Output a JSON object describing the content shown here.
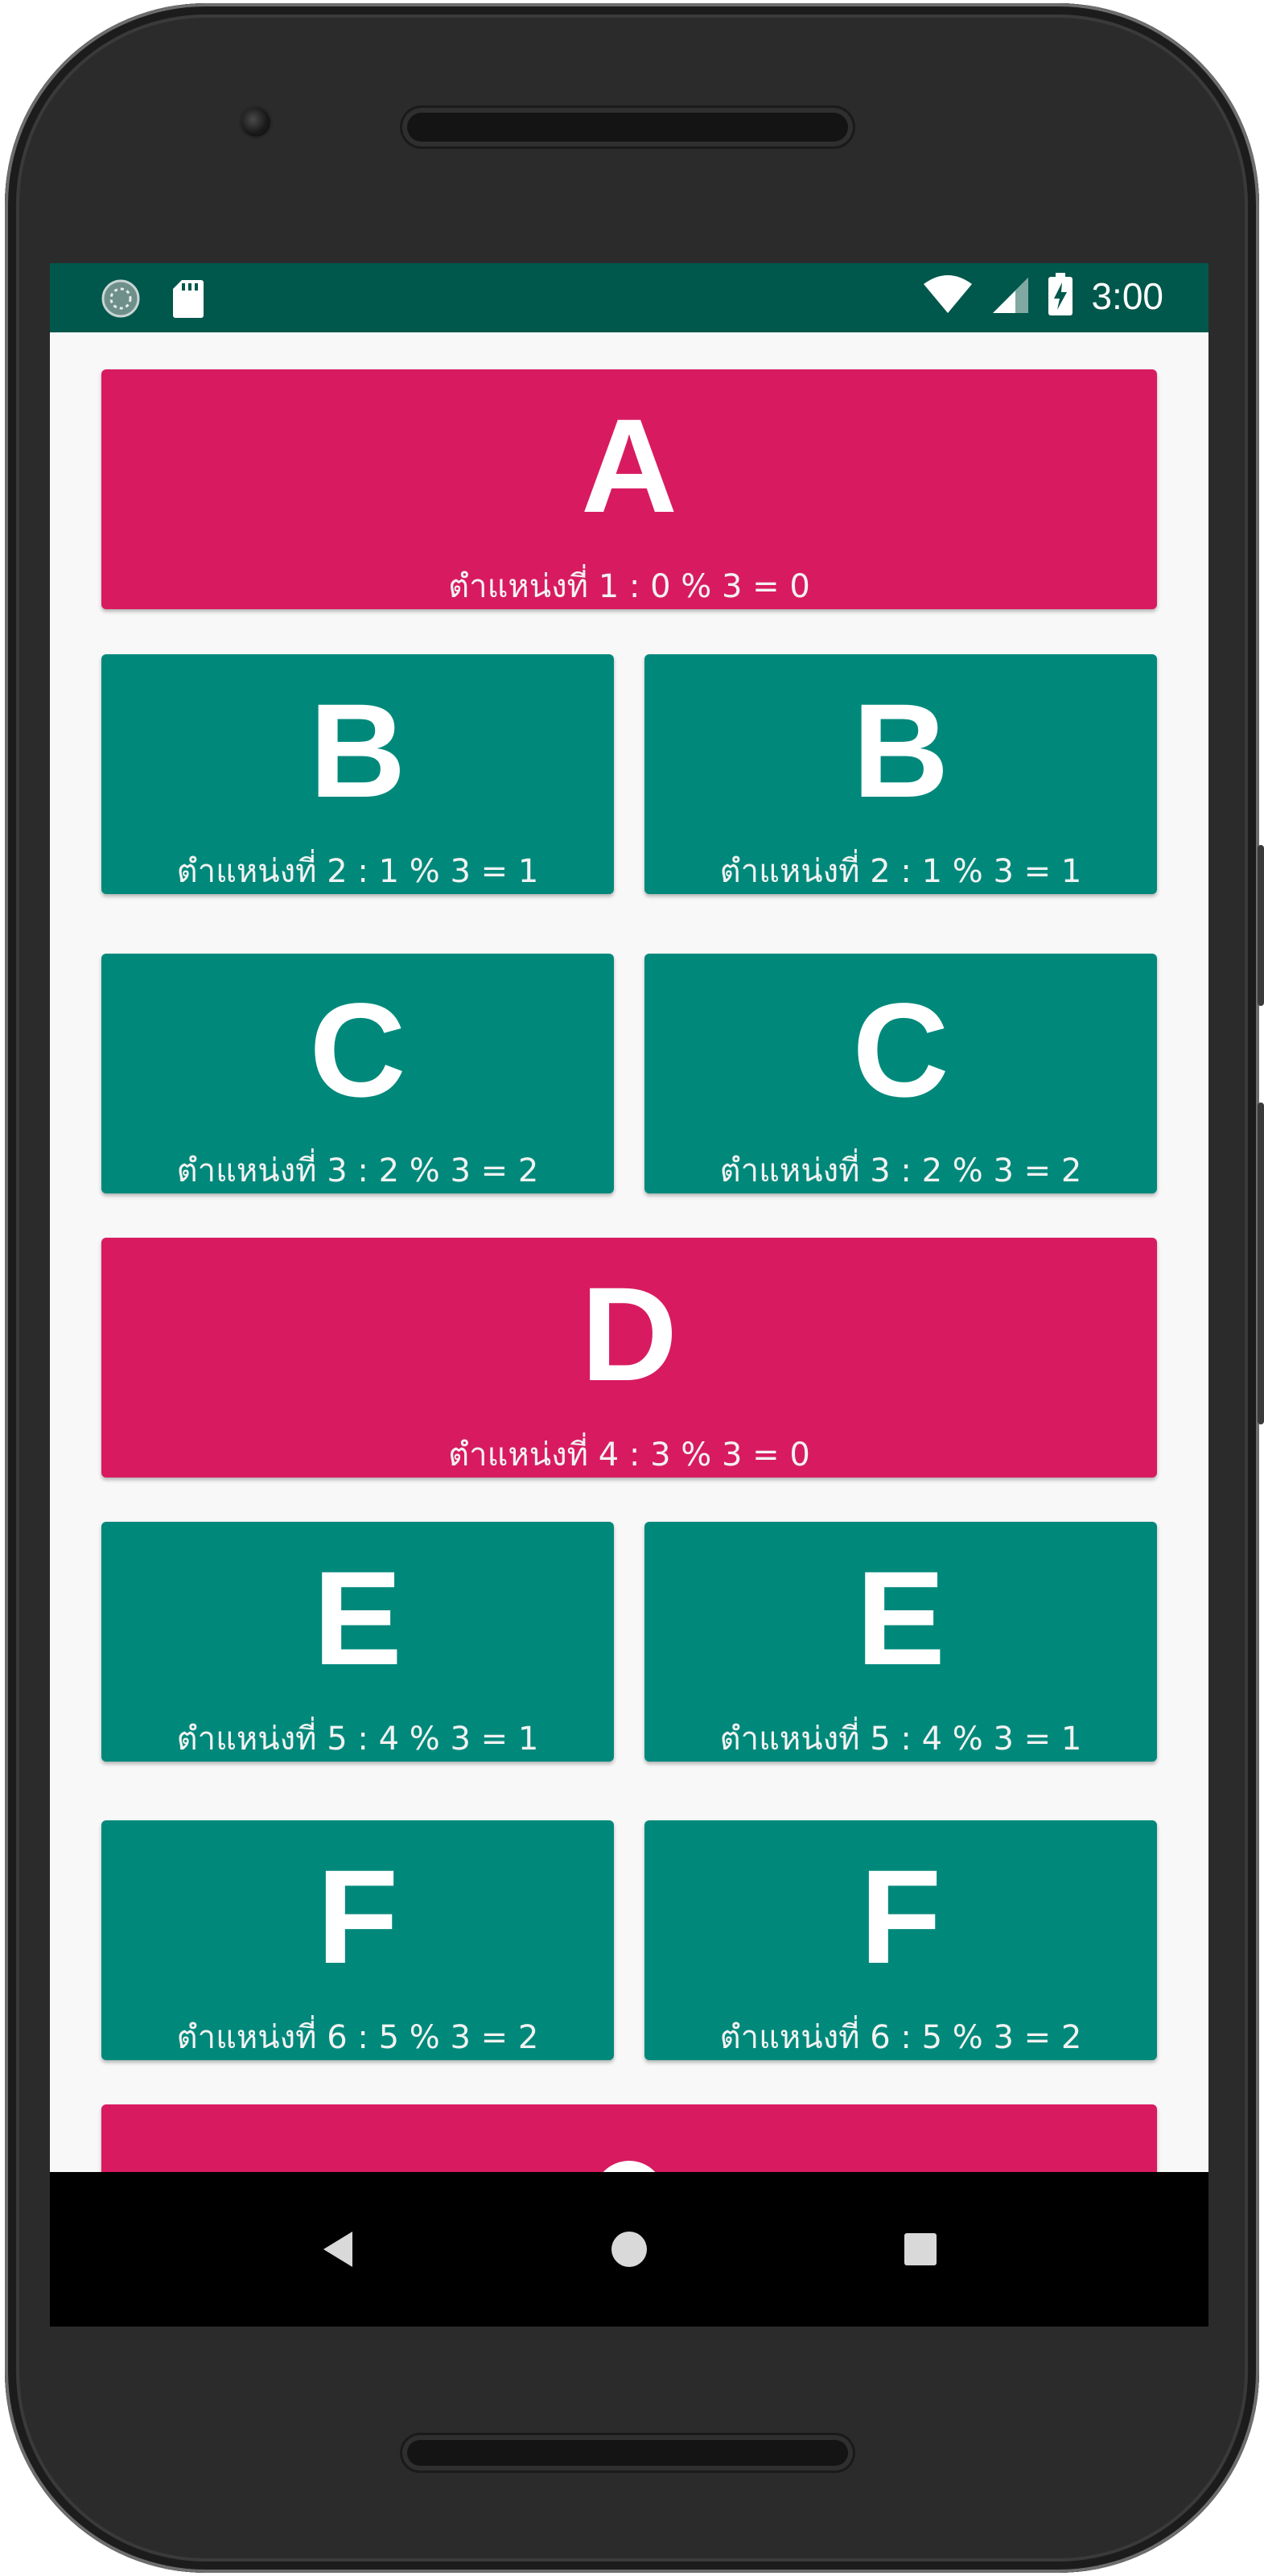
{
  "status_bar": {
    "time": "3:00",
    "icons": [
      "sync-circle-icon",
      "sd-card-icon",
      "wifi-icon",
      "cellular-signal-icon",
      "battery-charging-icon"
    ],
    "background": "#00574b"
  },
  "colors": {
    "full_width_card": "#d81b60",
    "half_width_card": "#00897b",
    "screen_background": "#f8f8f8"
  },
  "cards": [
    {
      "letter": "A",
      "position_text": "ตำแหน่งที่ 1 : 0 % 3 = 0"
    },
    {
      "letter": "B",
      "position_text": "ตำแหน่งที่ 2 : 1 % 3 = 1"
    },
    {
      "letter": "B",
      "position_text": "ตำแหน่งที่ 2 : 1 % 3 = 1"
    },
    {
      "letter": "C",
      "position_text": "ตำแหน่งที่ 3 : 2 % 3 = 2"
    },
    {
      "letter": "C",
      "position_text": "ตำแหน่งที่ 3 : 2 % 3 = 2"
    },
    {
      "letter": "D",
      "position_text": "ตำแหน่งที่ 4 : 3 % 3 = 0"
    },
    {
      "letter": "E",
      "position_text": "ตำแหน่งที่ 5 : 4 % 3 = 1"
    },
    {
      "letter": "E",
      "position_text": "ตำแหน่งที่ 5 : 4 % 3 = 1"
    },
    {
      "letter": "F",
      "position_text": "ตำแหน่งที่ 6 : 5 % 3 = 2"
    },
    {
      "letter": "F",
      "position_text": "ตำแหน่งที่ 6 : 5 % 3 = 2"
    }
  ],
  "nav_bar": {
    "buttons": [
      "back-icon",
      "home-icon",
      "recents-icon"
    ]
  }
}
